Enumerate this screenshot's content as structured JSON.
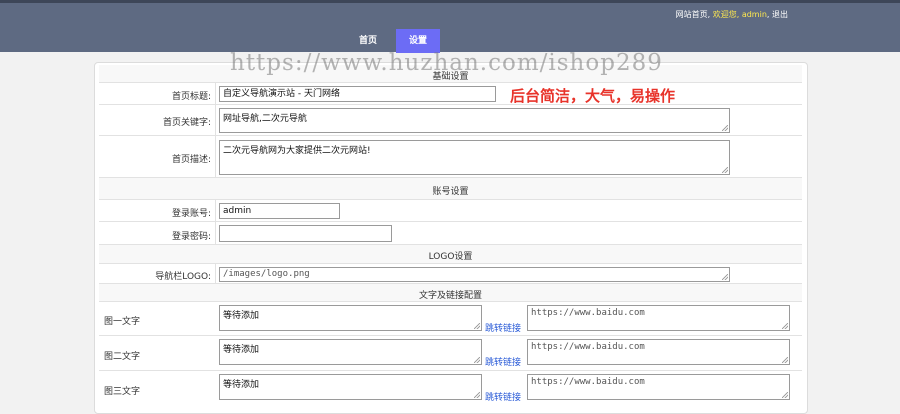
{
  "header": {
    "links": {
      "site_home": "网站首页",
      "welcome": "欢迎您,",
      "user": "admin",
      "comma": ",",
      "logout": "退出"
    },
    "nav": {
      "home": "首页",
      "settings": "设置"
    }
  },
  "watermark": "https://www.huzhan.com/ishop289",
  "promo": "后台简洁，大气，易操作",
  "basic": {
    "section": "基础设置",
    "title_label": "首页标题:",
    "title_value": "自定义导航演示站 - 天门网络",
    "keywords_label": "首页关键字:",
    "keywords_value": "网址导航,二次元导航",
    "desc_label": "首页描述:",
    "desc_value": "二次元导航网为大家提供二次元网站!"
  },
  "account": {
    "section": "账号设置",
    "user_label": "登录账号:",
    "user_value": "admin",
    "pass_label": "登录密码:",
    "pass_value": ""
  },
  "logo": {
    "section": "LOGO设置",
    "label": "导航栏LOGO:",
    "value": "/images/logo.png"
  },
  "links": {
    "section": "文字及链接配置",
    "link_label": "跳转链接",
    "items": [
      {
        "label": "图一文字",
        "text": "等待添加",
        "url": "https://www.baidu.com"
      },
      {
        "label": "图二文字",
        "text": "等待添加",
        "url": "https://www.baidu.com"
      },
      {
        "label": "图三文字",
        "text": "等待添加",
        "url": "https://www.baidu.com"
      }
    ]
  }
}
